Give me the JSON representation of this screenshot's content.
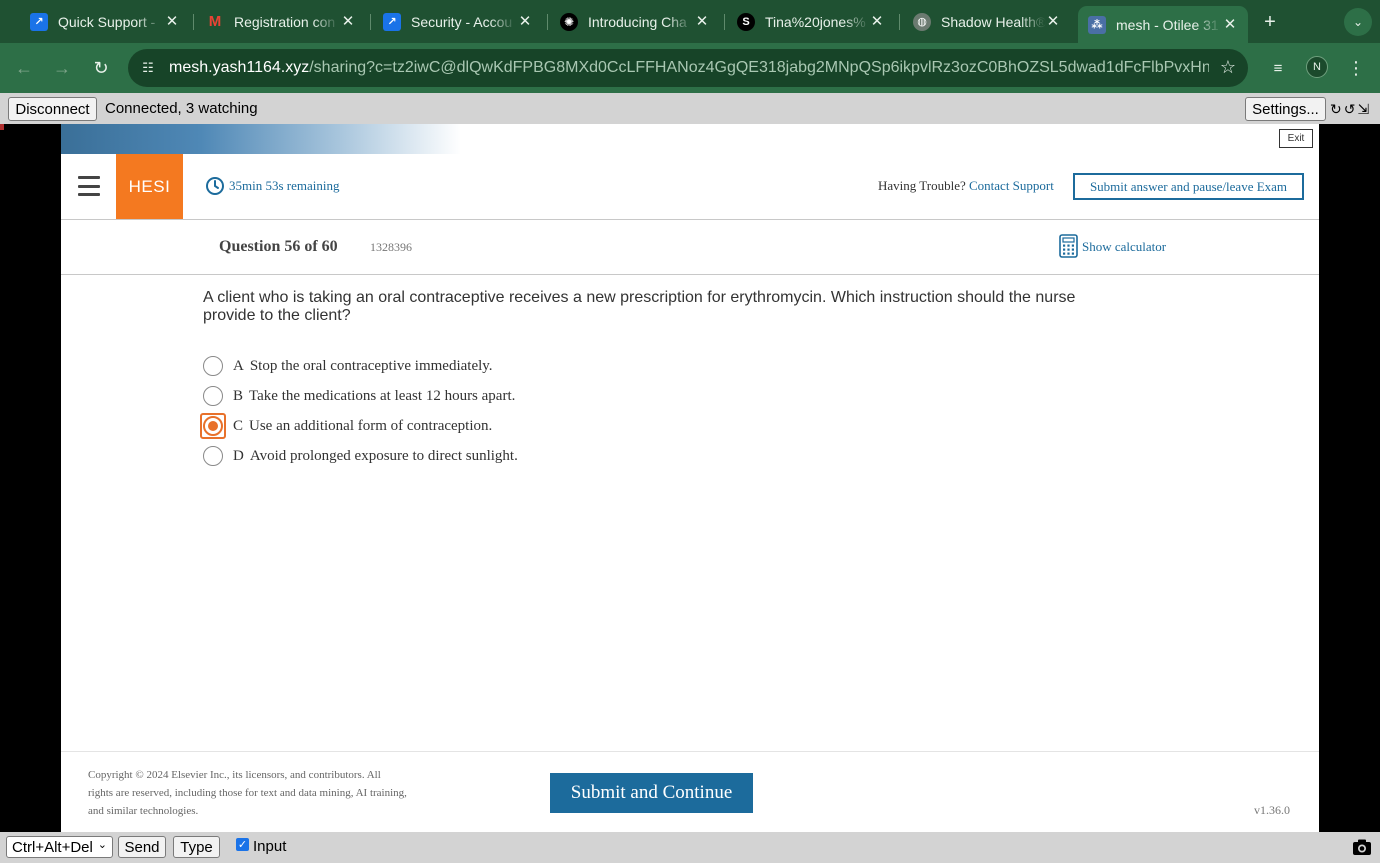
{
  "browser": {
    "tabs": [
      {
        "title": "Quick Support -",
        "favicon": "arrow-icon",
        "color": "#1a73e8"
      },
      {
        "title": "Registration con",
        "favicon": "gmail-icon",
        "color": "#ea4335"
      },
      {
        "title": "Security - Accou",
        "favicon": "arrow-icon",
        "color": "#1a73e8"
      },
      {
        "title": "Introducing Cha",
        "favicon": "openai-icon",
        "color": "#000000"
      },
      {
        "title": "Tina%20jones%",
        "favicon": "document-icon",
        "color": "#000000"
      },
      {
        "title": "Shadow Health®",
        "favicon": "globe-icon",
        "color": "#6b7a70"
      },
      {
        "title": "mesh - Otilee 31",
        "favicon": "mesh-icon",
        "color": "#4a6fa5"
      }
    ],
    "url_host": "mesh.yash1164.xyz",
    "url_path": "/sharing?c=tz2iwC@dlQwKdFPBG8MXd0CcLFFHANoz4GgQE318jabg2MNpQSp6ikpvlRz3ozC0BhOZSL5dwad1dFcFlbPvxHn...",
    "profile_initial": "N"
  },
  "viewer": {
    "disconnect_label": "Disconnect",
    "status": "Connected, 3 watching",
    "settings_label": "Settings...",
    "key_combo": "Ctrl+Alt+Del",
    "send_label": "Send",
    "type_label": "Type",
    "input_label": "Input",
    "input_checked": true
  },
  "exam": {
    "exit_label": "Exit",
    "logo": "HESI",
    "timer": "35min 53s remaining",
    "trouble_text": "Having Trouble?",
    "contact_label": "Contact Support",
    "submit_pause_label": "Submit answer and pause/leave Exam",
    "question_number": "Question 56 of 60",
    "question_id": "1328396",
    "calculator_label": "Show calculator",
    "question_text": "A client who is taking an oral contraceptive receives a new prescription for erythromycin. Which instruction should the nurse provide to the client?",
    "options": [
      {
        "letter": "A",
        "text": "Stop the oral contraceptive immediately.",
        "selected": false
      },
      {
        "letter": "B",
        "text": "Take the medications at least 12 hours apart.",
        "selected": false
      },
      {
        "letter": "C",
        "text": "Use an additional form of contraception.",
        "selected": true
      },
      {
        "letter": "D",
        "text": "Avoid prolonged exposure to direct sunlight.",
        "selected": false
      }
    ],
    "copyright": "Copyright © 2024 Elsevier Inc., its licensors, and contributors. All rights are reserved, including those for text and data mining, AI training, and similar technologies.",
    "submit_continue_label": "Submit and Continue",
    "version": "v1.36.0",
    "accent_color": "#f47920",
    "link_color": "#1c6b9c"
  }
}
